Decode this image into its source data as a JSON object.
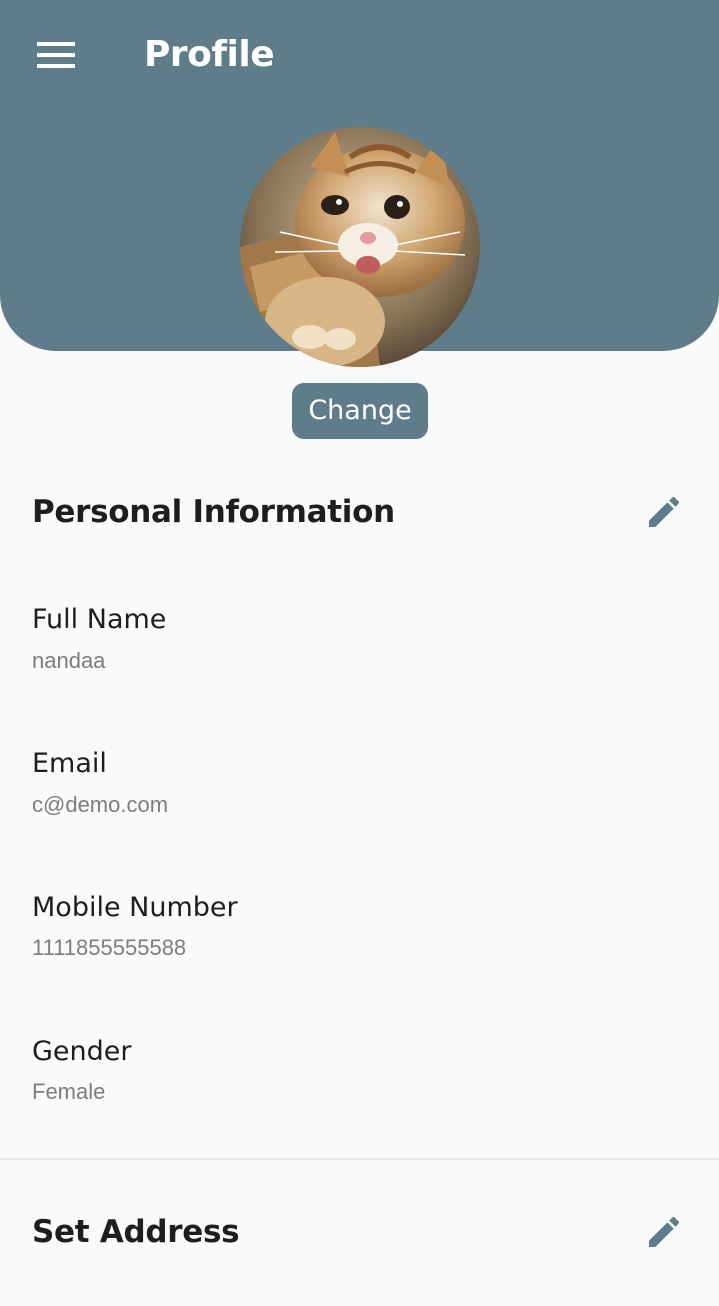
{
  "header": {
    "title": "Profile",
    "menu_icon": "hamburger-menu-icon",
    "background_color": "#5f7c8b"
  },
  "avatar": {
    "description_icon": "cat-photo"
  },
  "change_button": {
    "label": "Change"
  },
  "personal_information": {
    "title": "Personal Information",
    "edit_icon": "pencil-icon",
    "fields": [
      {
        "label": "Full Name",
        "value": "nandaa"
      },
      {
        "label": "Email",
        "value": "c@demo.com"
      },
      {
        "label": "Mobile Number",
        "value": "1111855555588"
      },
      {
        "label": "Gender",
        "value": "Female"
      }
    ]
  },
  "address": {
    "title": "Set Address",
    "edit_icon": "pencil-icon"
  }
}
